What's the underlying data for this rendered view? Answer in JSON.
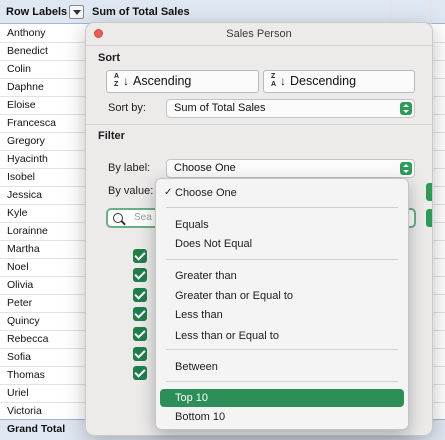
{
  "pivot": {
    "header": {
      "row_labels": "Row Labels",
      "sum_col": "Sum of Total Sales"
    },
    "rows": [
      "Anthony",
      "Benedict",
      "Colin",
      "Daphne",
      "Eloise",
      "Francesca",
      "Gregory",
      "Hyacinth",
      "Isobel",
      "Jessica",
      "Kyle",
      "Lorainne",
      "Martha",
      "Noel",
      "Olivia",
      "Peter",
      "Quincy",
      "Rebecca",
      "Sofia",
      "Thomas",
      "Uriel",
      "Victoria"
    ],
    "grand_total": "Grand Total"
  },
  "popover": {
    "title": "Sales Person",
    "sort_heading": "Sort",
    "ascending_label": "Ascending",
    "descending_label": "Descending",
    "sort_by_label": "Sort by:",
    "sort_by_value": "Sum of Total Sales",
    "filter_heading": "Filter",
    "by_label_label": "By label:",
    "by_label_value": "Choose One",
    "by_value_label": "By value:",
    "search_placeholder": "Sea"
  },
  "menu": {
    "items": [
      {
        "label": "Choose One",
        "checked": true
      },
      {
        "label": "Equals"
      },
      {
        "label": "Does Not Equal"
      },
      {
        "label": "Greater than"
      },
      {
        "label": "Greater than or Equal to"
      },
      {
        "label": "Less than"
      },
      {
        "label": "Less than or Equal to"
      },
      {
        "label": "Between"
      },
      {
        "label": "Top 10",
        "selected": true
      },
      {
        "label": "Bottom 10"
      }
    ],
    "check_glyph": "✓"
  },
  "colors": {
    "accent": "#2c8f58",
    "header_fill": "#dfe7f2",
    "close": "#ee5b52"
  }
}
